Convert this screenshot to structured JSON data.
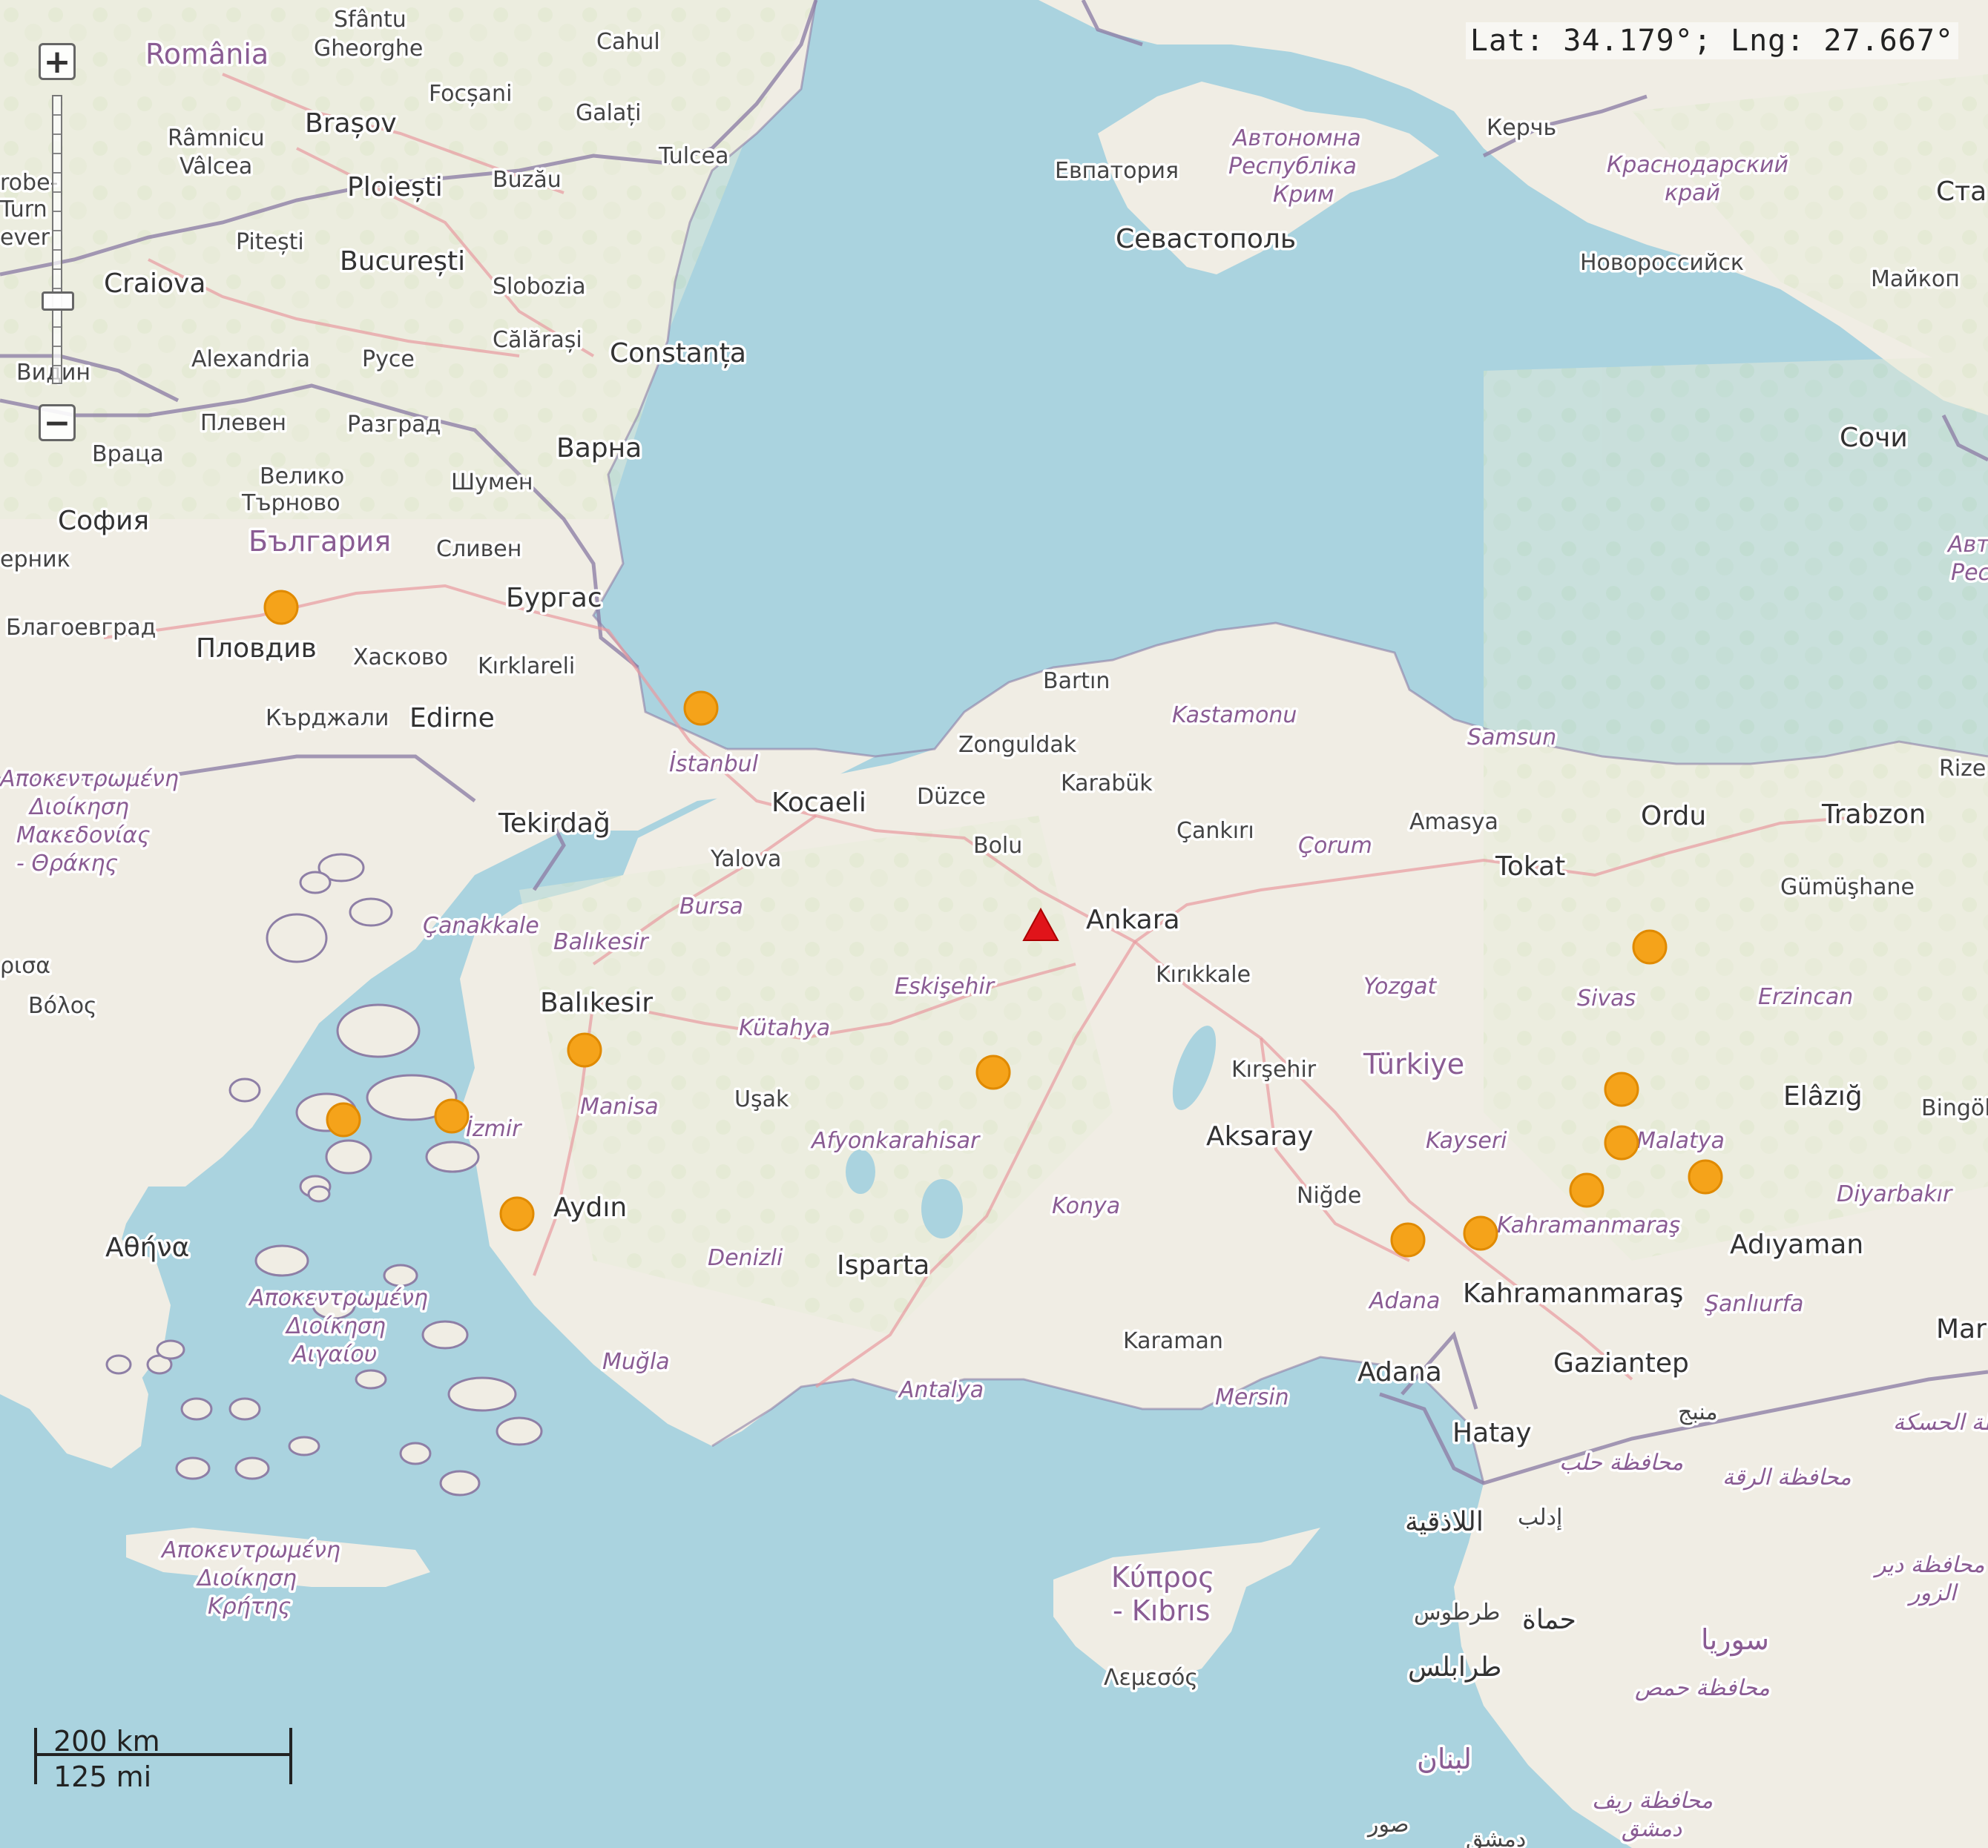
{
  "coordinates": {
    "text": "Lat: 34.179°; Lng: 27.667°"
  },
  "zoom": {
    "in_label": "+",
    "out_label": "−"
  },
  "scale": {
    "km": "200 km",
    "mi": "125 mi"
  },
  "colors": {
    "sea": "#aad3df",
    "land": "#f0ede4",
    "earthquake_marker": "#f5a31a",
    "station_marker": "#e0141a",
    "border": "#8e7fa6",
    "road": "#e89aa0"
  },
  "marker_icons": {
    "event": "orange-circle-icon",
    "station": "red-triangle-icon"
  },
  "labels": {
    "countries": [
      {
        "id": "romania",
        "text": "România"
      },
      {
        "id": "bulgaria",
        "text": "България"
      },
      {
        "id": "turkiye",
        "text": "Türkiye"
      },
      {
        "id": "syria",
        "text": "سوريا"
      },
      {
        "id": "cyprus",
        "text": "Κύπρος"
      },
      {
        "id": "cyprus2",
        "text": "- Kıbrıs"
      },
      {
        "id": "lebanon",
        "text": "لبنان"
      }
    ],
    "capitals": [
      {
        "id": "bucuresti",
        "text": "București"
      },
      {
        "id": "sofia",
        "text": "София"
      },
      {
        "id": "ankara",
        "text": "Ankara"
      },
      {
        "id": "athina",
        "text": "Αθήνα"
      }
    ],
    "cities": [
      {
        "id": "sfantu",
        "text": "Sfântu"
      },
      {
        "id": "gheorghe",
        "text": "Gheorghe"
      },
      {
        "id": "cahul",
        "text": "Cahul"
      },
      {
        "id": "focsani",
        "text": "Focșani"
      },
      {
        "id": "galati",
        "text": "Galați"
      },
      {
        "id": "brasov",
        "text": "Brașov"
      },
      {
        "id": "ramnicu",
        "text": "Râmnicu"
      },
      {
        "id": "valcea",
        "text": "Vâlcea"
      },
      {
        "id": "tulcea",
        "text": "Tulcea"
      },
      {
        "id": "ploiesti",
        "text": "Ploiești"
      },
      {
        "id": "buzau",
        "text": "Buzău"
      },
      {
        "id": "pitesti",
        "text": "Pitești"
      },
      {
        "id": "craiova",
        "text": "Craiova"
      },
      {
        "id": "slobozia",
        "text": "Slobozia"
      },
      {
        "id": "calarasi",
        "text": "Călărași"
      },
      {
        "id": "constanta",
        "text": "Constanța"
      },
      {
        "id": "alexandria",
        "text": "Alexandria"
      },
      {
        "id": "ruse",
        "text": "Русе"
      },
      {
        "id": "vidin",
        "text": "Видин"
      },
      {
        "id": "pleven",
        "text": "Плевен"
      },
      {
        "id": "razgrad",
        "text": "Разград"
      },
      {
        "id": "varna",
        "text": "Варна"
      },
      {
        "id": "vratsa",
        "text": "Враца"
      },
      {
        "id": "veliko",
        "text": "Велико"
      },
      {
        "id": "tarnovo",
        "text": "Търново"
      },
      {
        "id": "shumen",
        "text": "Шумен"
      },
      {
        "id": "sliven",
        "text": "Сливен"
      },
      {
        "id": "burgas",
        "text": "Бургас"
      },
      {
        "id": "pernik",
        "text": "ерник"
      },
      {
        "id": "blagoevgrad",
        "text": "Благоевград"
      },
      {
        "id": "plovdiv",
        "text": "Пловдив"
      },
      {
        "id": "haskovo",
        "text": "Хасково"
      },
      {
        "id": "kardzhali",
        "text": "Кърджали"
      },
      {
        "id": "edirne",
        "text": "Edirne"
      },
      {
        "id": "kirklareli",
        "text": "Kırklareli"
      },
      {
        "id": "tekirdag",
        "text": "Tekirdağ"
      },
      {
        "id": "kocaeli",
        "text": "Kocaeli"
      },
      {
        "id": "yalova",
        "text": "Yalova"
      },
      {
        "id": "duzce",
        "text": "Düzce"
      },
      {
        "id": "bolu",
        "text": "Bolu"
      },
      {
        "id": "zonguldak",
        "text": "Zonguldak"
      },
      {
        "id": "bartin",
        "text": "Bartın"
      },
      {
        "id": "karabuk",
        "text": "Karabük"
      },
      {
        "id": "cankiri",
        "text": "Çankırı"
      },
      {
        "id": "amasya",
        "text": "Amasya"
      },
      {
        "id": "tokat",
        "text": "Tokat"
      },
      {
        "id": "ordu",
        "text": "Ordu"
      },
      {
        "id": "trabzon",
        "text": "Trabzon"
      },
      {
        "id": "rize",
        "text": "Rize"
      },
      {
        "id": "gumushane",
        "text": "Gümüşhane"
      },
      {
        "id": "kirikkale",
        "text": "Kırıkkale"
      },
      {
        "id": "kirsehir",
        "text": "Kırşehir"
      },
      {
        "id": "aksaray",
        "text": "Aksaray"
      },
      {
        "id": "nigde",
        "text": "Niğde"
      },
      {
        "id": "balikesir",
        "text": "Balıkesir"
      },
      {
        "id": "usak",
        "text": "Uşak"
      },
      {
        "id": "aydin",
        "text": "Aydın"
      },
      {
        "id": "isparta",
        "text": "Isparta"
      },
      {
        "id": "karaman",
        "text": "Karaman"
      },
      {
        "id": "adana",
        "text": "Adana"
      },
      {
        "id": "kahramanmaras",
        "text": "Kahramanmaraş"
      },
      {
        "id": "gaziantep",
        "text": "Gaziantep"
      },
      {
        "id": "adiyaman",
        "text": "Adıyaman"
      },
      {
        "id": "elazig",
        "text": "Elâzığ"
      },
      {
        "id": "bingol",
        "text": "Bingöl"
      },
      {
        "id": "mar",
        "text": "Mar"
      },
      {
        "id": "hatay",
        "text": "Hatay"
      },
      {
        "id": "volos",
        "text": "Βόλος"
      },
      {
        "id": "larisa",
        "text": "ρισα"
      },
      {
        "id": "lemesos",
        "text": "Λεμεσός"
      },
      {
        "id": "yevpatoria",
        "text": "Евпатория"
      },
      {
        "id": "sevastopol",
        "text": "Севастополь"
      },
      {
        "id": "kerch",
        "text": "Керчь"
      },
      {
        "id": "novorossiysk",
        "text": "Новороссийск"
      },
      {
        "id": "maykop",
        "text": "Майкоп"
      },
      {
        "id": "sochi",
        "text": "Сочи"
      },
      {
        "id": "stav",
        "text": "Ста"
      },
      {
        "id": "turnu1",
        "text": "robe-"
      },
      {
        "id": "turnu2",
        "text": "Turn"
      },
      {
        "id": "turnu3",
        "text": "ever"
      },
      {
        "id": "manbij",
        "text": "منبج"
      },
      {
        "id": "idlib",
        "text": "إدلب"
      },
      {
        "id": "latakia",
        "text": "اللاذقية"
      },
      {
        "id": "hama",
        "text": "حماة"
      },
      {
        "id": "tartus",
        "text": "طرطوس"
      },
      {
        "id": "tripoli",
        "text": "طرابلس"
      },
      {
        "id": "sur",
        "text": "صور"
      },
      {
        "id": "dimashq",
        "text": "دمشق"
      }
    ],
    "regions": [
      {
        "id": "istanbul",
        "text": "İstanbul"
      },
      {
        "id": "bursa",
        "text": "Bursa"
      },
      {
        "id": "canakkale",
        "text": "Çanakkale"
      },
      {
        "id": "balikesir_r",
        "text": "Balıkesir"
      },
      {
        "id": "kutahya",
        "text": "Kütahya"
      },
      {
        "id": "eskisehir",
        "text": "Eskişehir"
      },
      {
        "id": "manisa",
        "text": "Manisa"
      },
      {
        "id": "izmir",
        "text": "İzmir"
      },
      {
        "id": "afyon",
        "text": "Afyonkarahisar"
      },
      {
        "id": "denizli",
        "text": "Denizli"
      },
      {
        "id": "mugla",
        "text": "Muğla"
      },
      {
        "id": "antalya",
        "text": "Antalya"
      },
      {
        "id": "konya",
        "text": "Konya"
      },
      {
        "id": "mersin",
        "text": "Mersin"
      },
      {
        "id": "adana_r",
        "text": "Adana"
      },
      {
        "id": "kayseri",
        "text": "Kayseri"
      },
      {
        "id": "yozgat",
        "text": "Yozgat"
      },
      {
        "id": "corum",
        "text": "Çorum"
      },
      {
        "id": "kastamonu",
        "text": "Kastamonu"
      },
      {
        "id": "samsun",
        "text": "Samsun"
      },
      {
        "id": "sivas",
        "text": "Sivas"
      },
      {
        "id": "erzincan",
        "text": "Erzincan"
      },
      {
        "id": "malatya",
        "text": "Malatya"
      },
      {
        "id": "kahramanmaras_r",
        "text": "Kahramanmaraş"
      },
      {
        "id": "sanliurfa",
        "text": "Şanlıurfa"
      },
      {
        "id": "diyarbakir",
        "text": "Diyarbakır"
      },
      {
        "id": "crimea1",
        "text": "Автономна"
      },
      {
        "id": "crimea2",
        "text": "Республіка"
      },
      {
        "id": "crimea3",
        "text": "Крим"
      },
      {
        "id": "krasnodar1",
        "text": "Краснодарский"
      },
      {
        "id": "krasnodar2",
        "text": "край"
      },
      {
        "id": "macedonia1",
        "text": "Αποκεντρωμένη"
      },
      {
        "id": "macedonia2",
        "text": "Διοίκηση"
      },
      {
        "id": "macedonia3",
        "text": "Μακεδονίας"
      },
      {
        "id": "macedonia4",
        "text": "- Θράκης"
      },
      {
        "id": "aegean1",
        "text": "Αποκεντρωμένη"
      },
      {
        "id": "aegean2",
        "text": "Διοίκηση"
      },
      {
        "id": "aegean3",
        "text": "Αιγαίου"
      },
      {
        "id": "crete1",
        "text": "Αποκεντρωμένη"
      },
      {
        "id": "crete2",
        "text": "Διοίκηση"
      },
      {
        "id": "crete3",
        "text": "Κρήτης"
      },
      {
        "id": "aleppo",
        "text": "محافظة حلب"
      },
      {
        "id": "raqqa",
        "text": "محافظة الرقة"
      },
      {
        "id": "hasakah",
        "text": "محافظة الحسكة"
      },
      {
        "id": "deir1",
        "text": "محافظة دير"
      },
      {
        "id": "deir2",
        "text": "الزور"
      },
      {
        "id": "homs",
        "text": "محافظة حمص"
      },
      {
        "id": "rif",
        "text": "محافظة ريف"
      },
      {
        "id": "rif2",
        "text": "دمشق"
      },
      {
        "id": "abkhaz",
        "text": "Авт"
      },
      {
        "id": "abkhaz2",
        "text": "Рес"
      }
    ]
  }
}
